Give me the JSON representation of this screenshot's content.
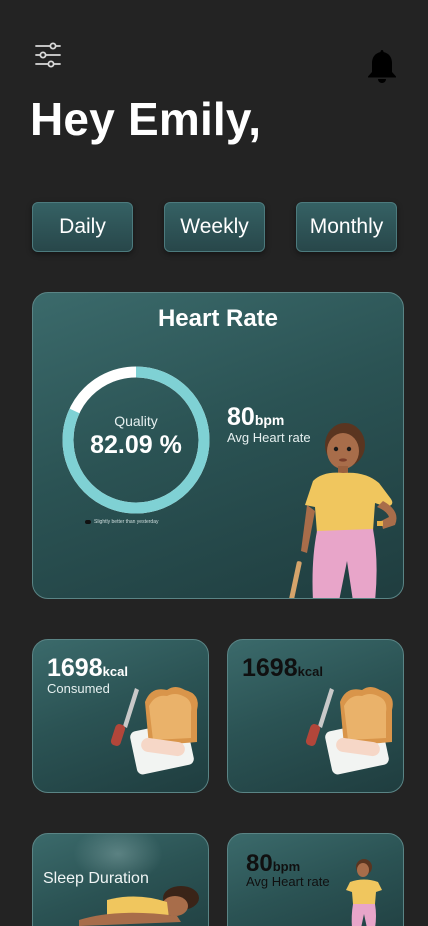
{
  "greeting": "Hey Emily,",
  "tabs": {
    "daily": "Daily",
    "weekly": "Weekly",
    "monthly": "Monthly"
  },
  "heart_rate": {
    "title": "Heart Rate",
    "quality_label": "Quality",
    "quality_value": "82.09 %",
    "quality_fraction": 0.82,
    "note": "Slightly better than yesterday",
    "bpm_value": "80",
    "bpm_unit": "bpm",
    "bpm_caption": "Avg Heart rate"
  },
  "calories": [
    {
      "value": "1698",
      "unit": "kcal",
      "caption": "Consumed"
    },
    {
      "value": "1698",
      "unit": "kcal",
      "caption": ""
    }
  ],
  "sleep": {
    "title": "Sleep Duration"
  },
  "heart_rate_small": {
    "value": "80",
    "unit": "bpm",
    "caption": "Avg Heart rate"
  },
  "colors": {
    "background": "#232323",
    "card": "#2b5354",
    "ring": "#7fd1d4",
    "ring_track": "#ffffff"
  },
  "icons": {
    "menu": "sliders-icon",
    "notifications": "bell-icon"
  }
}
